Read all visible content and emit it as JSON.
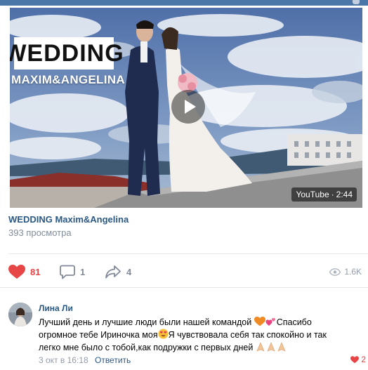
{
  "video": {
    "overlay_title": "WEDDING",
    "overlay_names": "MAXIM&ANGELINA",
    "source": "YouTube",
    "separator": "·",
    "duration": "2:44"
  },
  "post": {
    "title": "WEDDING Maxim&Angelina",
    "views": "393 просмотра"
  },
  "actions": {
    "likes": "81",
    "comments": "1",
    "shares": "4",
    "views": "1.6K"
  },
  "comment": {
    "author": "Лина Ли",
    "part1": "Лучший день и лучшие люди были нашей командой ",
    "part2": "Спасибо огромное тебе Ириночка моя",
    "part3": "Я чувствовала себя так спокойно и так легко мне было с тобой,как подружки с первых дней ",
    "date": "3 окт в 16:18",
    "reply": "Ответить",
    "likes": "2"
  },
  "colors": {
    "link": "#2a5885",
    "like": "#e64646",
    "muted": "#939cab",
    "header": "#4a76a8"
  }
}
